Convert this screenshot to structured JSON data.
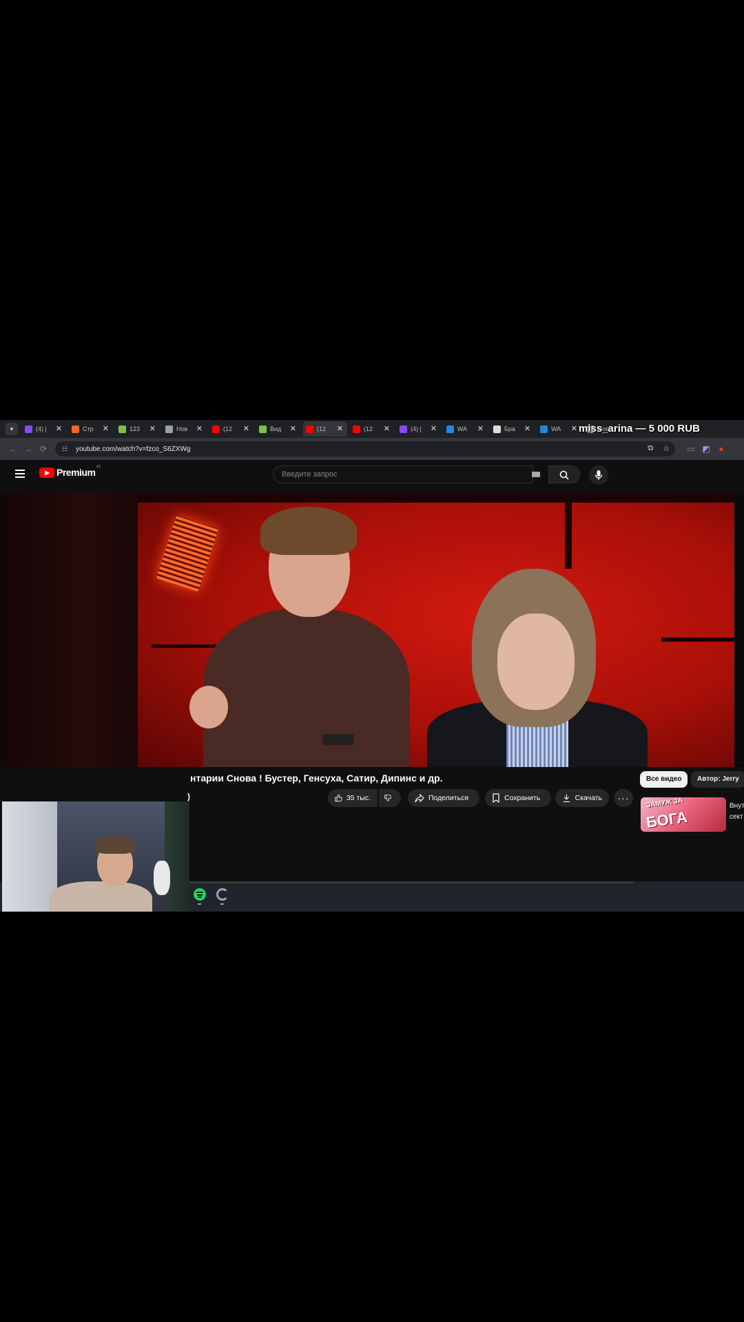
{
  "browser": {
    "tabs": [
      {
        "label": "(4) |",
        "favicon": "twitch-icon",
        "color": "#9146ff",
        "active": false
      },
      {
        "label": "Стр",
        "favicon": "orange-icon",
        "color": "#f26522",
        "active": false
      },
      {
        "label": "123",
        "favicon": "battery-icon",
        "color": "#7cc242",
        "active": false
      },
      {
        "label": "Нов",
        "favicon": "globe-icon",
        "color": "#9aa0a6",
        "active": false
      },
      {
        "label": "(12",
        "favicon": "youtube-icon",
        "color": "#ff0000",
        "active": false
      },
      {
        "label": "Вид",
        "favicon": "battery-icon",
        "color": "#7cc242",
        "active": false
      },
      {
        "label": "(12",
        "favicon": "youtube-icon",
        "color": "#ff0000",
        "active": true
      },
      {
        "label": "(12",
        "favicon": "youtube-icon",
        "color": "#ff0000",
        "active": false
      },
      {
        "label": "(4) |",
        "favicon": "twitch-icon",
        "color": "#9146ff",
        "active": false
      },
      {
        "label": "WA",
        "favicon": "w-icon",
        "color": "#1e88e5",
        "active": false
      },
      {
        "label": "Бра",
        "favicon": "pp-icon",
        "color": "#dddddd",
        "active": false
      },
      {
        "label": "WA",
        "favicon": "w-icon",
        "color": "#1e88e5",
        "active": false
      }
    ],
    "tab_close": "✕",
    "last_tab_label": "Нов",
    "url": "youtube.com/watch?v=fzco_S6ZXWg"
  },
  "donation": {
    "text": "miss_arina — 5 000 RUB"
  },
  "youtube": {
    "logo_text": "Premium",
    "logo_sup": "FI",
    "search_placeholder": "Введите запрос",
    "video_title": "нтарии Снова ! Бустер, Генсуха, Сатир, Дипинс и др.",
    "title_fragment": ")",
    "actions": {
      "like_count": "35 тыс.",
      "share": "Поделиться",
      "save": "Сохранить",
      "download": "Скачать",
      "more": "···"
    },
    "chips": {
      "all": "Все видео",
      "author": "Автор: Jerry"
    },
    "recommendation": {
      "thumb_text_top": "ЗАМУЖ ЗА",
      "thumb_text_big": "БОГА",
      "title_line1": "Внут",
      "title_line2": "сект"
    }
  },
  "colors": {
    "youtube_red": "#ff0000",
    "page_bg": "#0f0f0f",
    "pill_bg": "#272727",
    "spotify_green": "#1ed760"
  }
}
